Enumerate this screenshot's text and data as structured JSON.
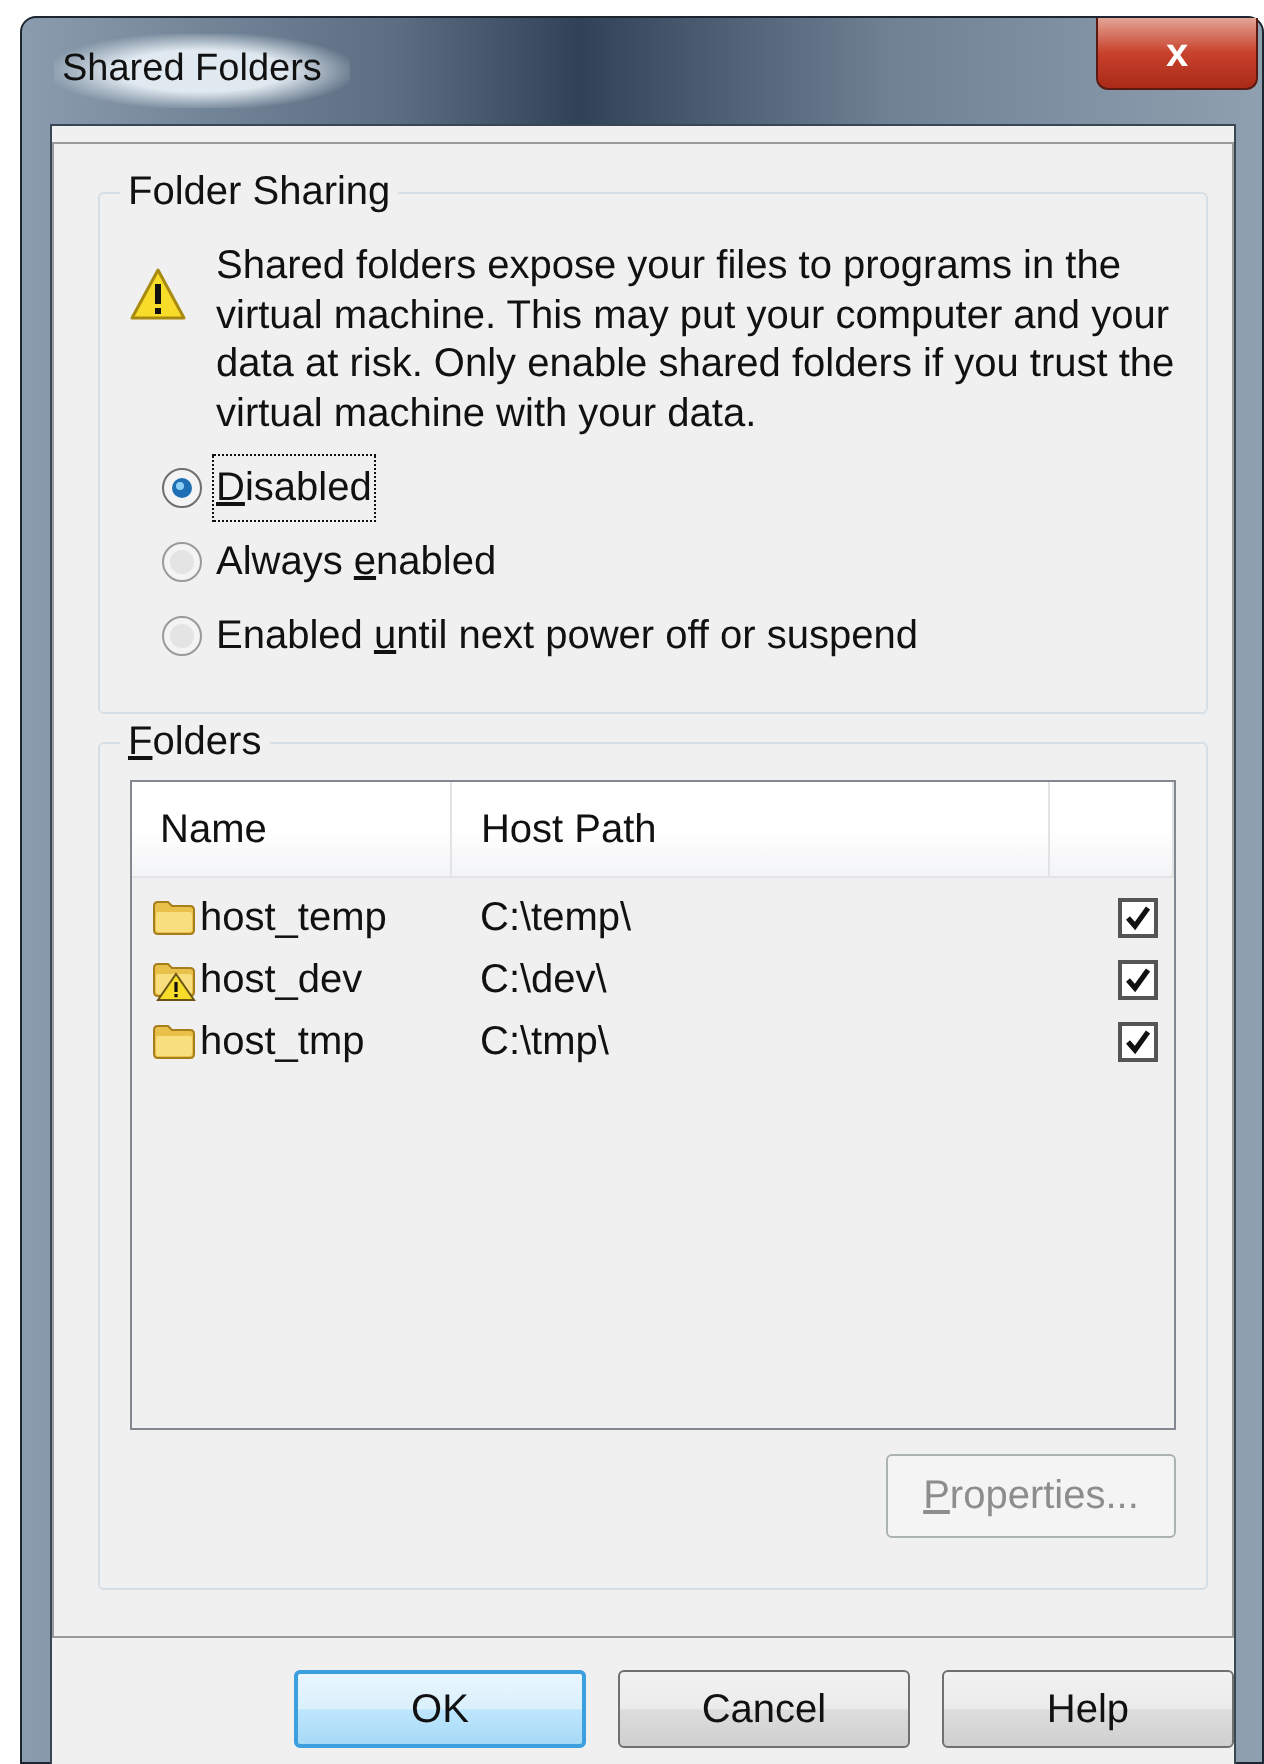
{
  "window": {
    "title": "Shared Folders",
    "close_label": "x"
  },
  "folder_sharing": {
    "title": "Folder Sharing",
    "warning": "Shared folders expose your files to programs in the virtual machine. This may put your computer and your data at risk. Only enable shared folders if you trust the virtual machine with your data.",
    "options": [
      {
        "label": {
          "key": "D",
          "post": "isabled"
        },
        "selected": true
      },
      {
        "label": {
          "pre": "Always ",
          "key": "e",
          "post": "nabled"
        },
        "selected": false
      },
      {
        "label": {
          "pre": "Enabled ",
          "key": "u",
          "post": "ntil next power off or suspend"
        },
        "selected": false
      }
    ]
  },
  "folders": {
    "title": {
      "key": "F",
      "post": "olders"
    },
    "columns": [
      "Name",
      "Host Path"
    ],
    "rows": [
      {
        "kind": "folder",
        "name": "host_temp",
        "path": "C:\\temp\\",
        "checked": true
      },
      {
        "kind": "warning-folder",
        "name": "host_dev",
        "path": "C:\\dev\\",
        "checked": true
      },
      {
        "kind": "folder",
        "name": "host_tmp",
        "path": "C:\\tmp\\",
        "checked": true
      }
    ],
    "properties_button": {
      "label": {
        "key": "P",
        "post": "roperties..."
      },
      "disabled": true
    }
  },
  "buttons": [
    {
      "label": "OK",
      "default": true
    },
    {
      "label": "Cancel",
      "default": false
    },
    {
      "label": "Help",
      "default": false
    }
  ]
}
